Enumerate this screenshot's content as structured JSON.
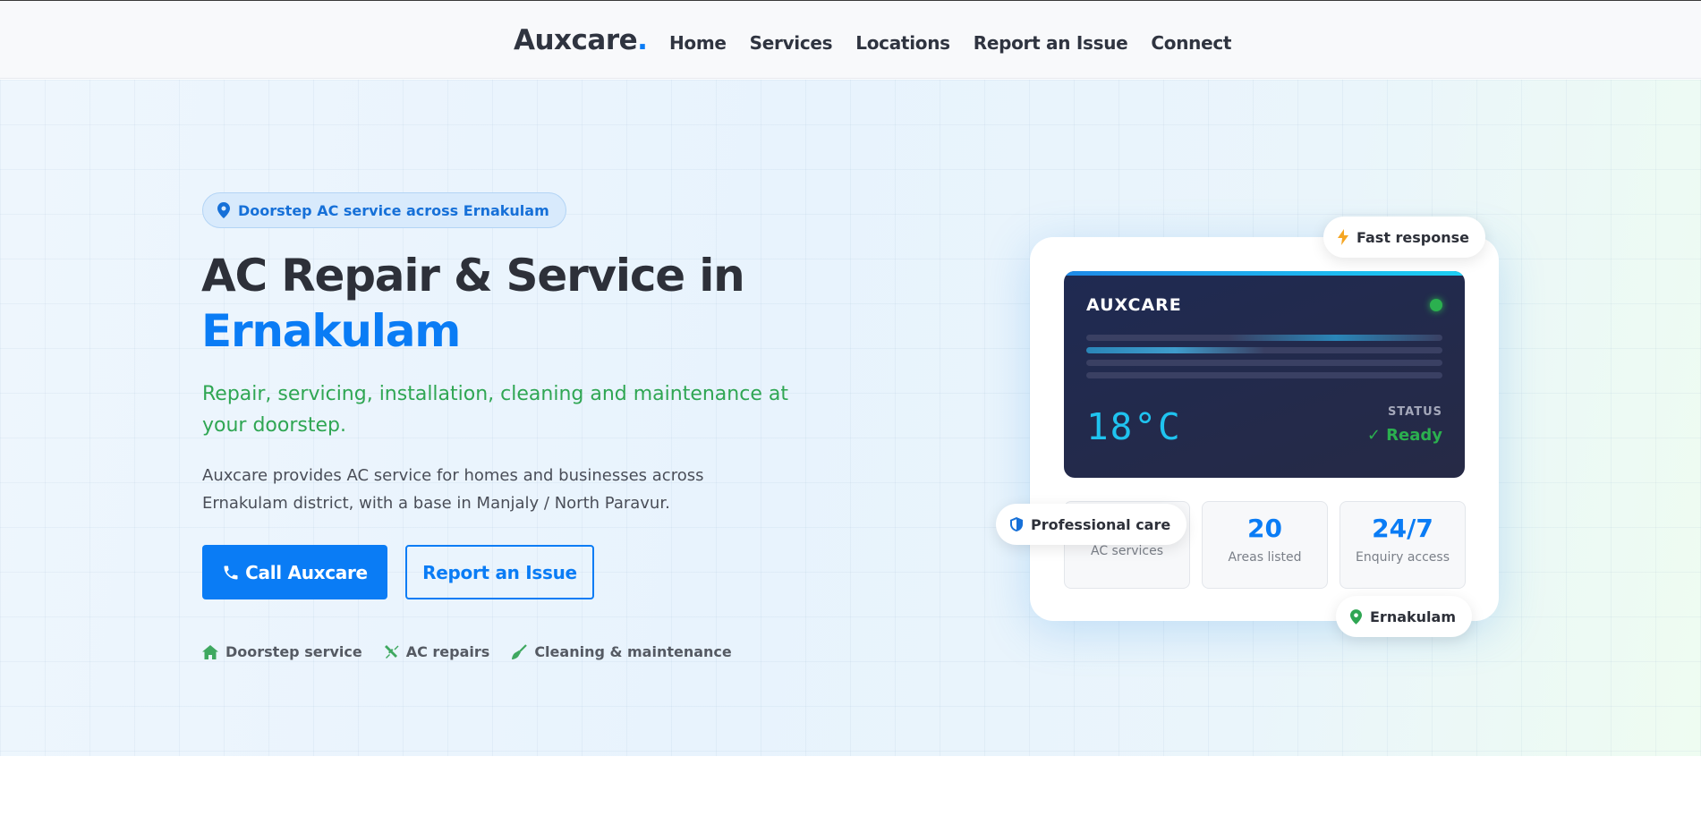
{
  "nav": {
    "brand": "Auxcare",
    "brand_dot": ".",
    "links": [
      "Home",
      "Services",
      "Locations",
      "Report an Issue",
      "Connect"
    ]
  },
  "hero": {
    "badge": "Doorstep AC service across Ernakulam",
    "title_line1": "AC Repair & Service in",
    "title_line2": "Ernakulam",
    "subtitle": "Repair, servicing, installation, cleaning and maintenance at your doorstep.",
    "description": "Auxcare provides AC service for homes and businesses across Ernakulam district, with a base in Manjaly / North Paravur.",
    "primary_button": "Call Auxcare",
    "secondary_button": "Report an Issue",
    "features": [
      {
        "icon": "home-icon",
        "label": "Doorstep service"
      },
      {
        "icon": "tools-icon",
        "label": "AC repairs"
      },
      {
        "icon": "broom-icon",
        "label": "Cleaning & maintenance"
      }
    ]
  },
  "card": {
    "screen_brand": "AUXCARE",
    "temperature": "18°C",
    "status_label": "STATUS",
    "status_value": "✓ Ready",
    "stats": [
      {
        "number": "",
        "label": "AC services"
      },
      {
        "number": "20",
        "label": "Areas listed"
      },
      {
        "number": "24/7",
        "label": "Enquiry access"
      }
    ],
    "pills": {
      "fast_response": "Fast response",
      "professional_care": "Professional care",
      "location": "Ernakulam"
    }
  },
  "colors": {
    "accent": "#0a7cf5",
    "green": "#2fa653",
    "dark": "#2d3039"
  }
}
